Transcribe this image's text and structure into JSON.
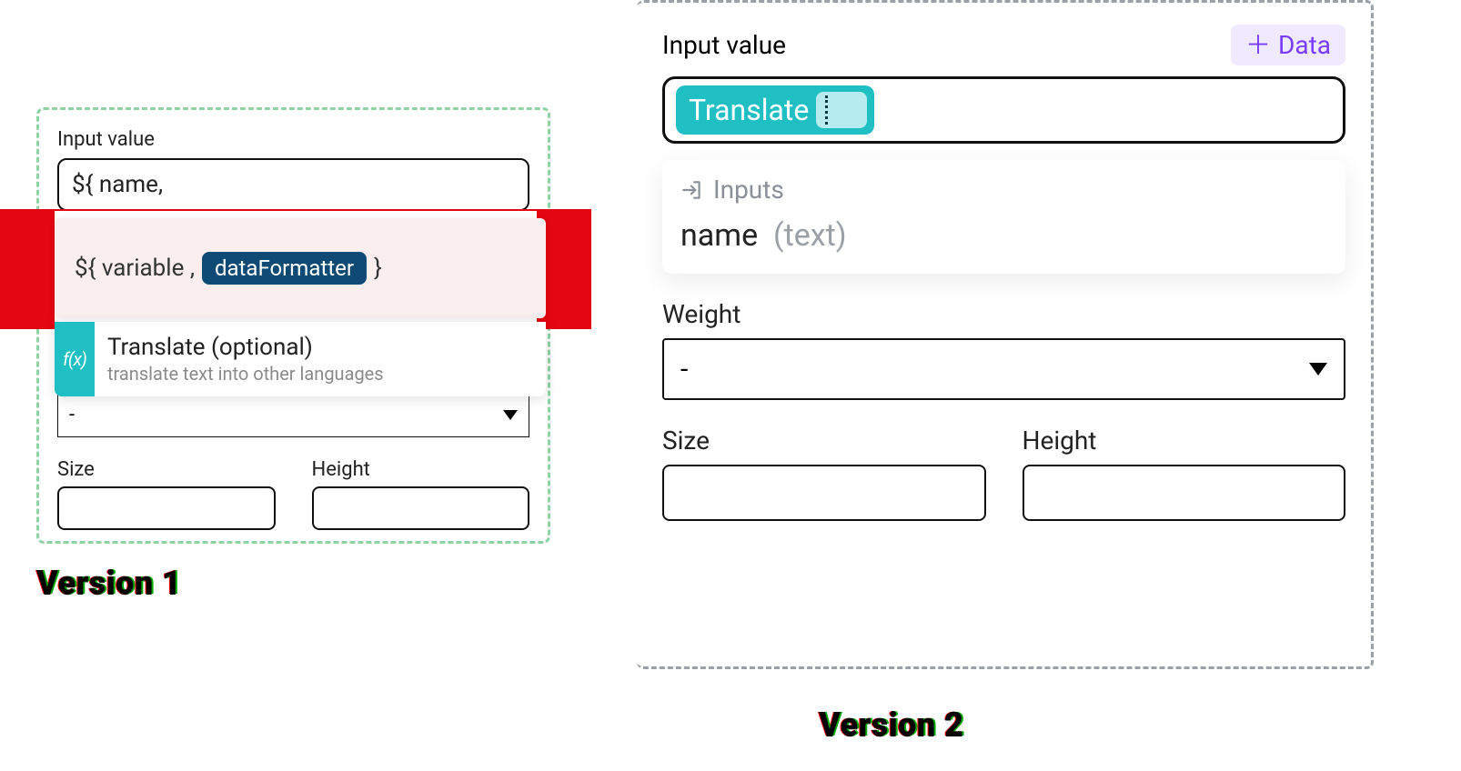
{
  "v1": {
    "caption": "Version 1",
    "input_value_label": "Input value",
    "input_value_text": "${ name,",
    "syntax": {
      "prefix": "${ variable ,",
      "chip": "dataFormatter",
      "suffix": "}"
    },
    "fn": {
      "icon_text": "f(x)",
      "title": "Translate (optional)",
      "desc": "translate text into other languages"
    },
    "select_value": "-",
    "size_label": "Size",
    "height_label": "Height"
  },
  "v2": {
    "caption": "Version 2",
    "input_value_label": "Input value",
    "data_button": "Data",
    "translate_pill": "Translate",
    "dropdown": {
      "section": "Inputs",
      "item_name": "name",
      "item_type": "(text)"
    },
    "weight_label": "Weight",
    "weight_select_value": "-",
    "size_label": "Size",
    "height_label": "Height"
  }
}
